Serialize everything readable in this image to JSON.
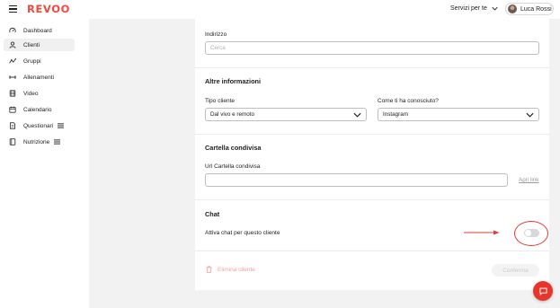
{
  "app": {
    "logo": "REVOO"
  },
  "header": {
    "services_label": "Servizi per te",
    "user_name": "Luca Rossi"
  },
  "sidebar": {
    "items": [
      {
        "label": "Dashboard",
        "icon": "gauge-icon"
      },
      {
        "label": "Clienti",
        "icon": "user-icon",
        "active": true
      },
      {
        "label": "Gruppi",
        "icon": "group-icon"
      },
      {
        "label": "Allenamenti",
        "icon": "dumbbell-icon"
      },
      {
        "label": "Video",
        "icon": "film-icon"
      },
      {
        "label": "Calendario",
        "icon": "calendar-icon"
      },
      {
        "label": "Questionari",
        "icon": "document-icon",
        "badge_icon": "list-icon"
      },
      {
        "label": "Nutrizione",
        "icon": "book-icon",
        "badge_icon": "list-icon"
      }
    ]
  },
  "form": {
    "address": {
      "label": "Indirizzo",
      "placeholder": "Cerca"
    },
    "other_info": {
      "title": "Altre informazioni",
      "client_type_label": "Tipo cliente",
      "client_type_value": "Dal vivo e remoto",
      "source_label": "Come ti ha conosciuto?",
      "source_value": "Instagram"
    },
    "shared_folder": {
      "title": "Cartella condivisa",
      "url_label": "Url Cartella condivisa",
      "url_value": "",
      "open_link": "Apri link"
    },
    "chat": {
      "title": "Chat",
      "toggle_label": "Attiva chat per questo cliente",
      "enabled": false
    },
    "actions": {
      "delete_label": "Elimina cliente",
      "confirm_label": "Conferma"
    }
  },
  "colors": {
    "brand": "#f0493e",
    "annotation": "#e53a31",
    "fab": "#e8342b"
  }
}
